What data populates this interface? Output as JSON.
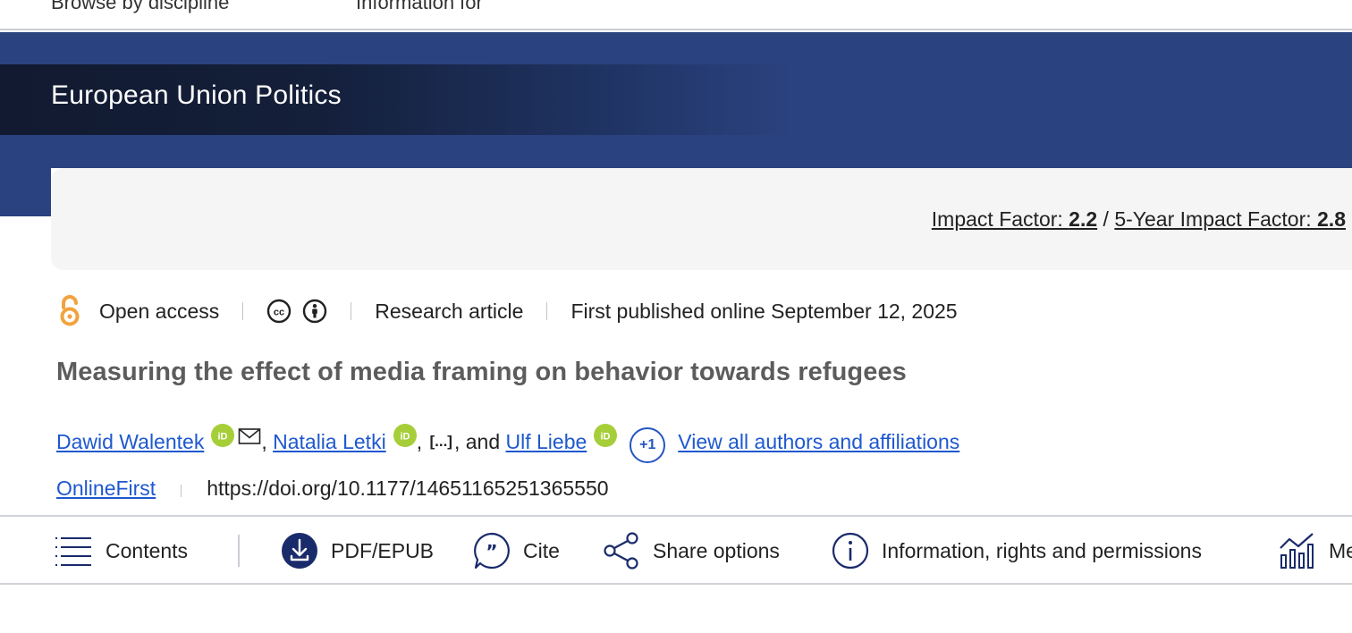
{
  "top_nav": {
    "item1": "Browse by discipline",
    "item2": "Information for"
  },
  "journal": {
    "title": "European Union Politics"
  },
  "impact": {
    "label1": "Impact Factor: ",
    "value1": "2.2",
    "slash": " / ",
    "label2": "5-Year Impact Factor: ",
    "value2": "2.8"
  },
  "meta": {
    "open_access": "Open access",
    "article_type": "Research article",
    "published": "First published online September 12, 2025"
  },
  "article": {
    "title": "Measuring the effect of media framing on behavior towards refugees"
  },
  "authors": {
    "author1": "Dawid Walentek",
    "author2": "Natalia Letki",
    "ellipsis": "[...]",
    "and": ", and ",
    "author3": "Ulf Liebe",
    "more_count": "+1",
    "view_all": "View all authors and affiliations"
  },
  "doi_row": {
    "status": "OnlineFirst",
    "doi": "https://doi.org/10.1177/14651165251365550"
  },
  "toolbar": {
    "contents": "Contents",
    "pdf": "PDF/EPUB",
    "cite": "Cite",
    "share": "Share options",
    "info": "Information, rights and permissions",
    "metrics": "Me"
  },
  "colors": {
    "banner": "#2b4280",
    "journal_bar": "#111a30",
    "link": "#1e58d0",
    "orcid": "#a6ce39",
    "open_access": "#f1a340",
    "icon_navy": "#1a2b6b"
  },
  "icons": [
    "open-access-icon",
    "creative-commons-icon",
    "attribution-icon",
    "orcid-icon",
    "mail-icon",
    "menu-lines-icon",
    "download-icon",
    "quote-icon",
    "share-icon",
    "info-icon",
    "bar-chart-icon"
  ]
}
